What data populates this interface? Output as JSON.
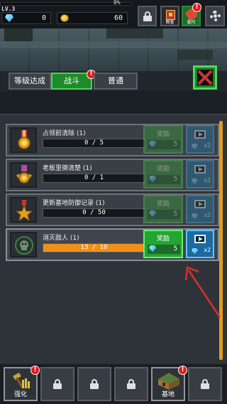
{
  "hud": {
    "level": "LV.3",
    "xp_percent_text": "0%",
    "gems": "0",
    "coins": "60",
    "dict_label": "图鉴",
    "task_label": "委托",
    "badge": "!"
  },
  "tabs": {
    "achieve": "等级达成",
    "battle": "战斗",
    "normal": "普通",
    "badge": "!"
  },
  "quests": [
    {
      "title": "占领前清除 (1)",
      "progress": "0 / 5",
      "fill": 0,
      "reward_label": "奖励",
      "reward_gems": "5",
      "ad_mult": "x2",
      "done": false
    },
    {
      "title": "老板里德清楚 (1)",
      "progress": "0 / 1",
      "fill": 0,
      "reward_label": "奖励",
      "reward_gems": "5",
      "ad_mult": "x2",
      "done": false
    },
    {
      "title": "更新基地防御记录 (1)",
      "progress": "0 / 50",
      "fill": 0,
      "reward_label": "奖励",
      "reward_gems": "5",
      "ad_mult": "x2",
      "done": false
    },
    {
      "title": "消灭敌人 (1)",
      "progress": "13 / 10",
      "fill": 1.0,
      "reward_label": "奖励",
      "reward_gems": "5",
      "ad_mult": "x2",
      "done": true
    }
  ],
  "nav": {
    "upgrade": "强化",
    "base": "基地",
    "badge": "!"
  },
  "colors": {
    "accent_green": "#23a531",
    "ad_blue": "#1c6aa0",
    "progress_orange": "#f0901a",
    "badge_red": "#e01a1a"
  }
}
